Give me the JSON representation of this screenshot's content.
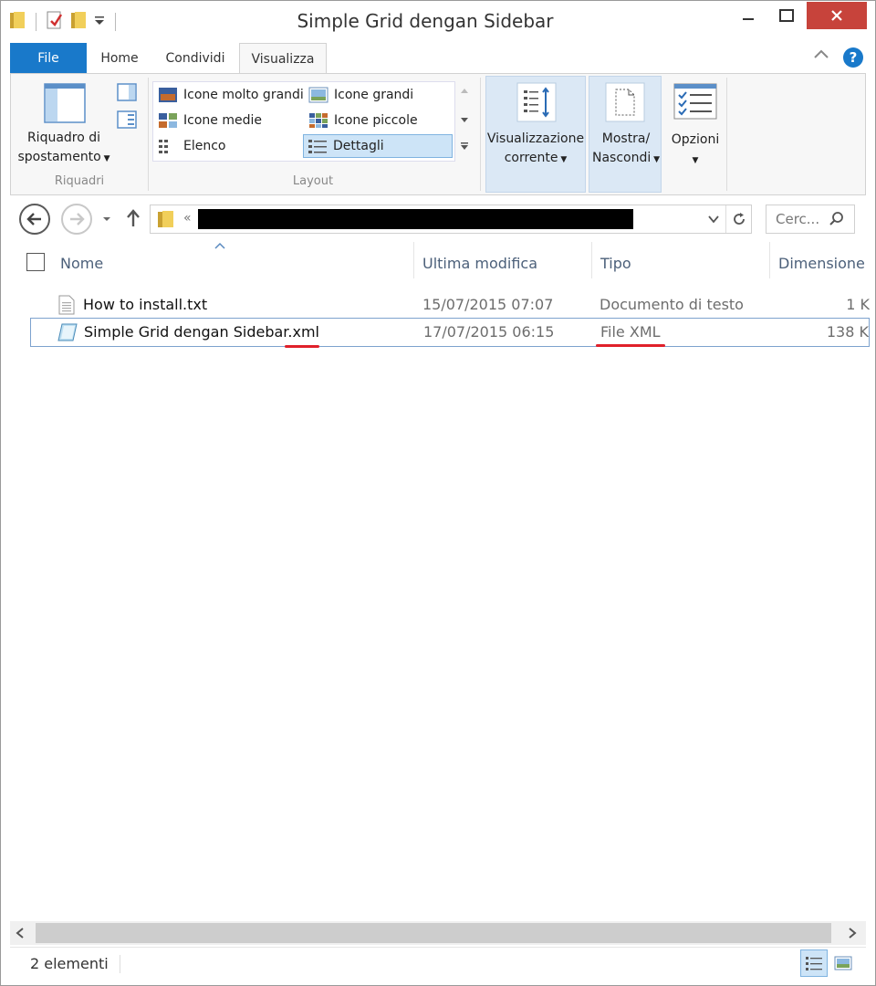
{
  "window": {
    "title": "Simple Grid dengan Sidebar"
  },
  "tabs": {
    "file": "File",
    "home": "Home",
    "condividi": "Condividi",
    "visualizza": "Visualizza"
  },
  "ribbon": {
    "riquadri": {
      "nav_pane_line1": "Riquadro di",
      "nav_pane_line2": "spostamento",
      "group_label": "Riquadri"
    },
    "layout": {
      "group_label": "Layout",
      "items": [
        "Icone molto grandi",
        "Icone grandi",
        "Icone medie",
        "Icone piccole",
        "Elenco",
        "Dettagli"
      ]
    },
    "current_view": {
      "line1": "Visualizzazione",
      "line2": "corrente"
    },
    "show_hide": {
      "line1": "Mostra/",
      "line2": "Nascondi"
    },
    "options": {
      "label": "Opzioni"
    }
  },
  "nav": {
    "breadcrumb_prefix": "«",
    "search_placeholder": "Cerc..."
  },
  "columns": {
    "name": "Nome",
    "modified": "Ultima modifica",
    "type": "Tipo",
    "size": "Dimensione"
  },
  "files": [
    {
      "name": "How to install.txt",
      "modified": "15/07/2015 07:07",
      "type": "Documento di testo",
      "size": "1 K"
    },
    {
      "name": "Simple Grid dengan Sidebar.xml",
      "modified": "17/07/2015 06:15",
      "type": "File XML",
      "size": "138 K"
    }
  ],
  "status": {
    "count": "2 elementi"
  },
  "colors": {
    "file_tab": "#1979ca",
    "close": "#c7433b",
    "selection": "#7da2ce",
    "annotation": "#e0202a"
  }
}
